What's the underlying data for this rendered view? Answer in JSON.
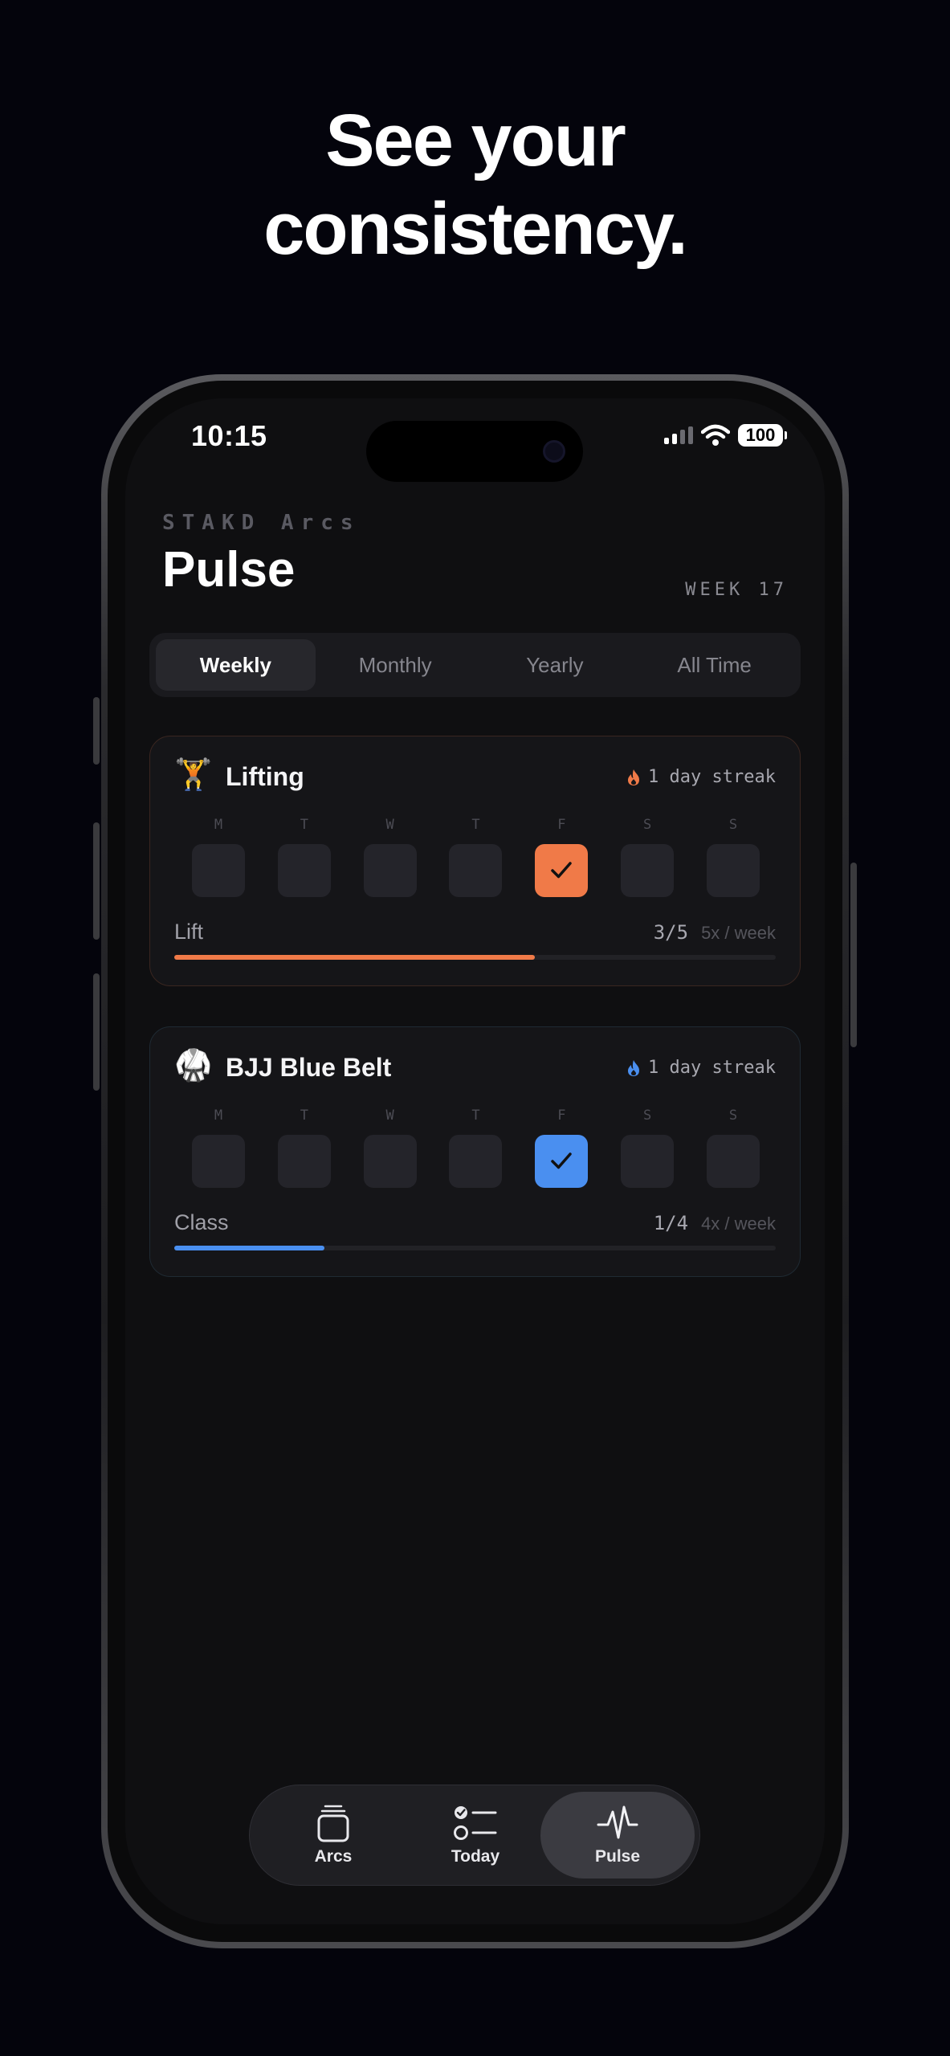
{
  "headline": {
    "line1": "See your",
    "line2": "consistency."
  },
  "status_bar": {
    "time": "10:15",
    "battery": "100"
  },
  "header": {
    "brand": "STAKD Arcs",
    "title": "Pulse",
    "week": "WEEK 17"
  },
  "tabs": [
    {
      "label": "Weekly",
      "active": true
    },
    {
      "label": "Monthly",
      "active": false
    },
    {
      "label": "Yearly",
      "active": false
    },
    {
      "label": "All Time",
      "active": false
    }
  ],
  "habits": [
    {
      "emoji": "🏋️",
      "name": "Lifting",
      "streak": "1 day streak",
      "accent": "#f07a48",
      "days": [
        "M",
        "T",
        "W",
        "T",
        "F",
        "S",
        "S"
      ],
      "checked_index": 4,
      "goal_label": "Lift",
      "count": "3/5",
      "frequency": "5x / week",
      "progress": 0.6
    },
    {
      "emoji": "🥋",
      "name": "BJJ Blue Belt",
      "streak": "1 day streak",
      "accent": "#4a8ff0",
      "days": [
        "M",
        "T",
        "W",
        "T",
        "F",
        "S",
        "S"
      ],
      "checked_index": 4,
      "goal_label": "Class",
      "count": "1/4",
      "frequency": "4x / week",
      "progress": 0.25
    }
  ],
  "tabbar": [
    {
      "label": "Arcs",
      "icon": "stack-icon",
      "active": false
    },
    {
      "label": "Today",
      "icon": "checklist-icon",
      "active": false
    },
    {
      "label": "Pulse",
      "icon": "pulse-icon",
      "active": true
    }
  ]
}
